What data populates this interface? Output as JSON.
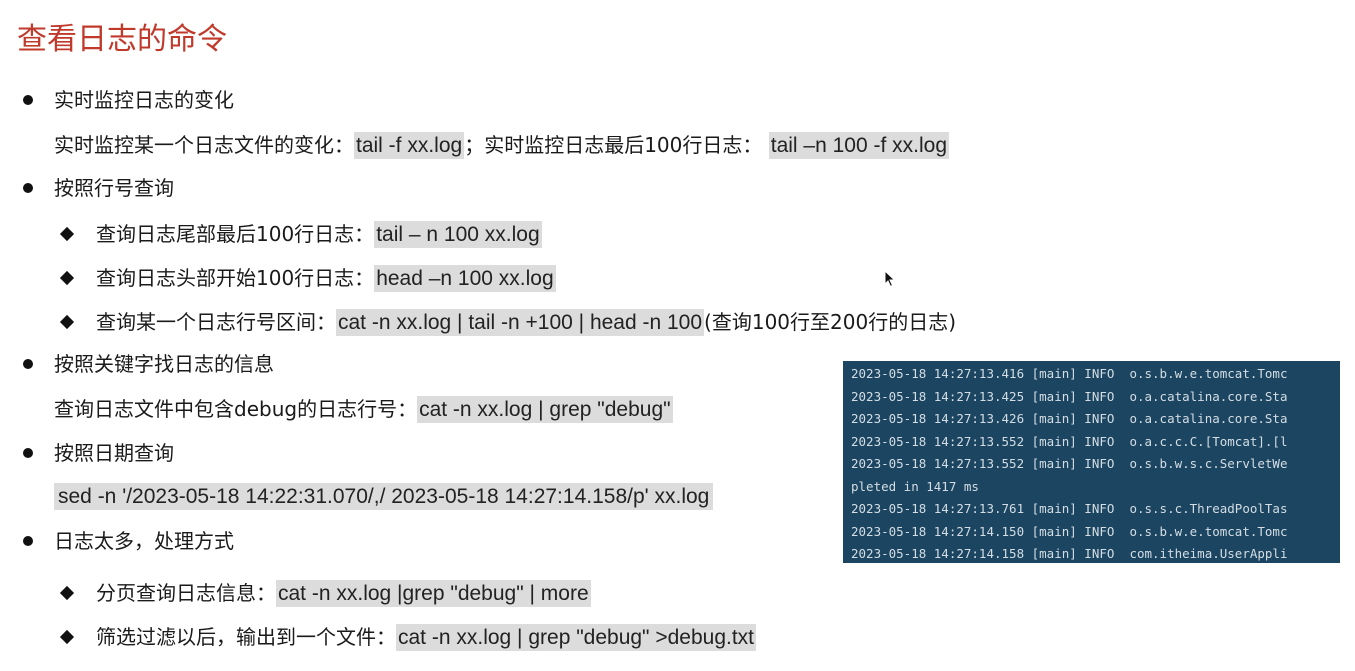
{
  "title": "查看日志的命令",
  "sections": [
    {
      "heading": "实时监控日志的变化",
      "line_prefix": "实时监控某一个日志文件的变化：",
      "code1": "tail -f xx.log",
      "mid": "；实时监控日志最后100行日志：",
      "code2": "tail –n 100 -f xx.log"
    },
    {
      "heading": "按照行号查询",
      "items": [
        {
          "label": "查询日志尾部最后100行日志：",
          "code": "tail – n 100 xx.log"
        },
        {
          "label": "查询日志头部开始100行日志：",
          "code": "head –n 100 xx.log"
        },
        {
          "label": "查询某一个日志行号区间：",
          "code": "cat -n xx.log | tail -n +100 | head -n 100",
          "suffix": "(查询100行至200行的日志)"
        }
      ]
    },
    {
      "heading": "按照关键字找日志的信息",
      "line_prefix": "查询日志文件中包含debug的日志行号：",
      "code": "cat -n xx.log | grep \"debug\""
    },
    {
      "heading": "按照日期查询",
      "code": "sed -n '/2023-05-18 14:22:31.070/,/ 2023-05-18 14:27:14.158/p'   xx.log"
    },
    {
      "heading": "日志太多，处理方式",
      "items": [
        {
          "label": "分页查询日志信息：",
          "code": "cat -n xx.log |grep \"debug\" | more"
        },
        {
          "label": "筛选过滤以后，输出到一个文件：",
          "code": "cat -n xx.log | grep \"debug\" >debug.txt"
        }
      ]
    }
  ],
  "terminal": {
    "lines": [
      "2023-05-18 14:27:13.416 [main] INFO  o.s.b.w.e.tomcat.Tomc",
      "2023-05-18 14:27:13.425 [main] INFO  o.a.catalina.core.Sta",
      "2023-05-18 14:27:13.426 [main] INFO  o.a.catalina.core.Sta",
      "2023-05-18 14:27:13.552 [main] INFO  o.a.c.c.C.[Tomcat].[l",
      "2023-05-18 14:27:13.552 [main] INFO  o.s.b.w.s.c.ServletWe",
      "pleted in 1417 ms",
      "2023-05-18 14:27:13.761 [main] INFO  o.s.s.c.ThreadPoolTas",
      "2023-05-18 14:27:14.150 [main] INFO  o.s.b.w.e.tomcat.Tomc",
      "2023-05-18 14:27:14.158 [main] INFO  com.itheima.UserAppli"
    ],
    "background": "#1b4560"
  },
  "colors": {
    "title": "#c0392b",
    "code_bg": "#dcdcdc"
  }
}
